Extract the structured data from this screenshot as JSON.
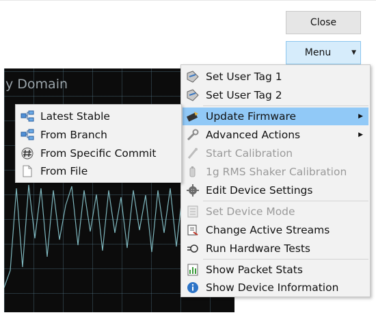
{
  "buttons": {
    "close_label": "Close",
    "menu_label": "Menu"
  },
  "chart": {
    "title": "y Domain",
    "trace_color": "#7fb8bf"
  },
  "main_menu": {
    "items": [
      {
        "label": "Set User Tag 1",
        "icon": "tag-icon",
        "enabled": true
      },
      {
        "label": "Set User Tag 2",
        "icon": "tag-icon",
        "enabled": true
      },
      {
        "label": "Update Firmware",
        "icon": "firmware-icon",
        "enabled": true,
        "submenu": true,
        "highlighted": true
      },
      {
        "label": "Advanced Actions",
        "icon": "wrench-icon",
        "enabled": true,
        "submenu": true
      },
      {
        "label": "Start Calibration",
        "icon": "calibration-icon",
        "enabled": false
      },
      {
        "label": "1g RMS Shaker Calibration",
        "icon": "shaker-icon",
        "enabled": false
      },
      {
        "label": "Edit Device Settings",
        "icon": "gear-icon",
        "enabled": true
      },
      {
        "label": "Set Device Mode",
        "icon": "list-icon",
        "enabled": false
      },
      {
        "label": "Change Active Streams",
        "icon": "streams-icon",
        "enabled": true
      },
      {
        "label": "Run Hardware Tests",
        "icon": "test-icon",
        "enabled": true
      },
      {
        "label": "Show Packet Stats",
        "icon": "bar-chart-icon",
        "enabled": true
      },
      {
        "label": "Show Device Information",
        "icon": "info-icon",
        "enabled": true
      }
    ]
  },
  "sub_menu": {
    "items": [
      {
        "label": "Latest Stable",
        "icon": "branch-tree-icon"
      },
      {
        "label": "From Branch",
        "icon": "branch-tree-icon"
      },
      {
        "label": "From Specific Commit",
        "icon": "hash-icon"
      },
      {
        "label": "From File",
        "icon": "file-icon"
      }
    ]
  },
  "colors": {
    "highlight": "#91c9f7",
    "menu_bg": "#f2f2f2",
    "chart_bg": "#0c0c0c",
    "menu_button_bg": "#d6ecfb"
  }
}
